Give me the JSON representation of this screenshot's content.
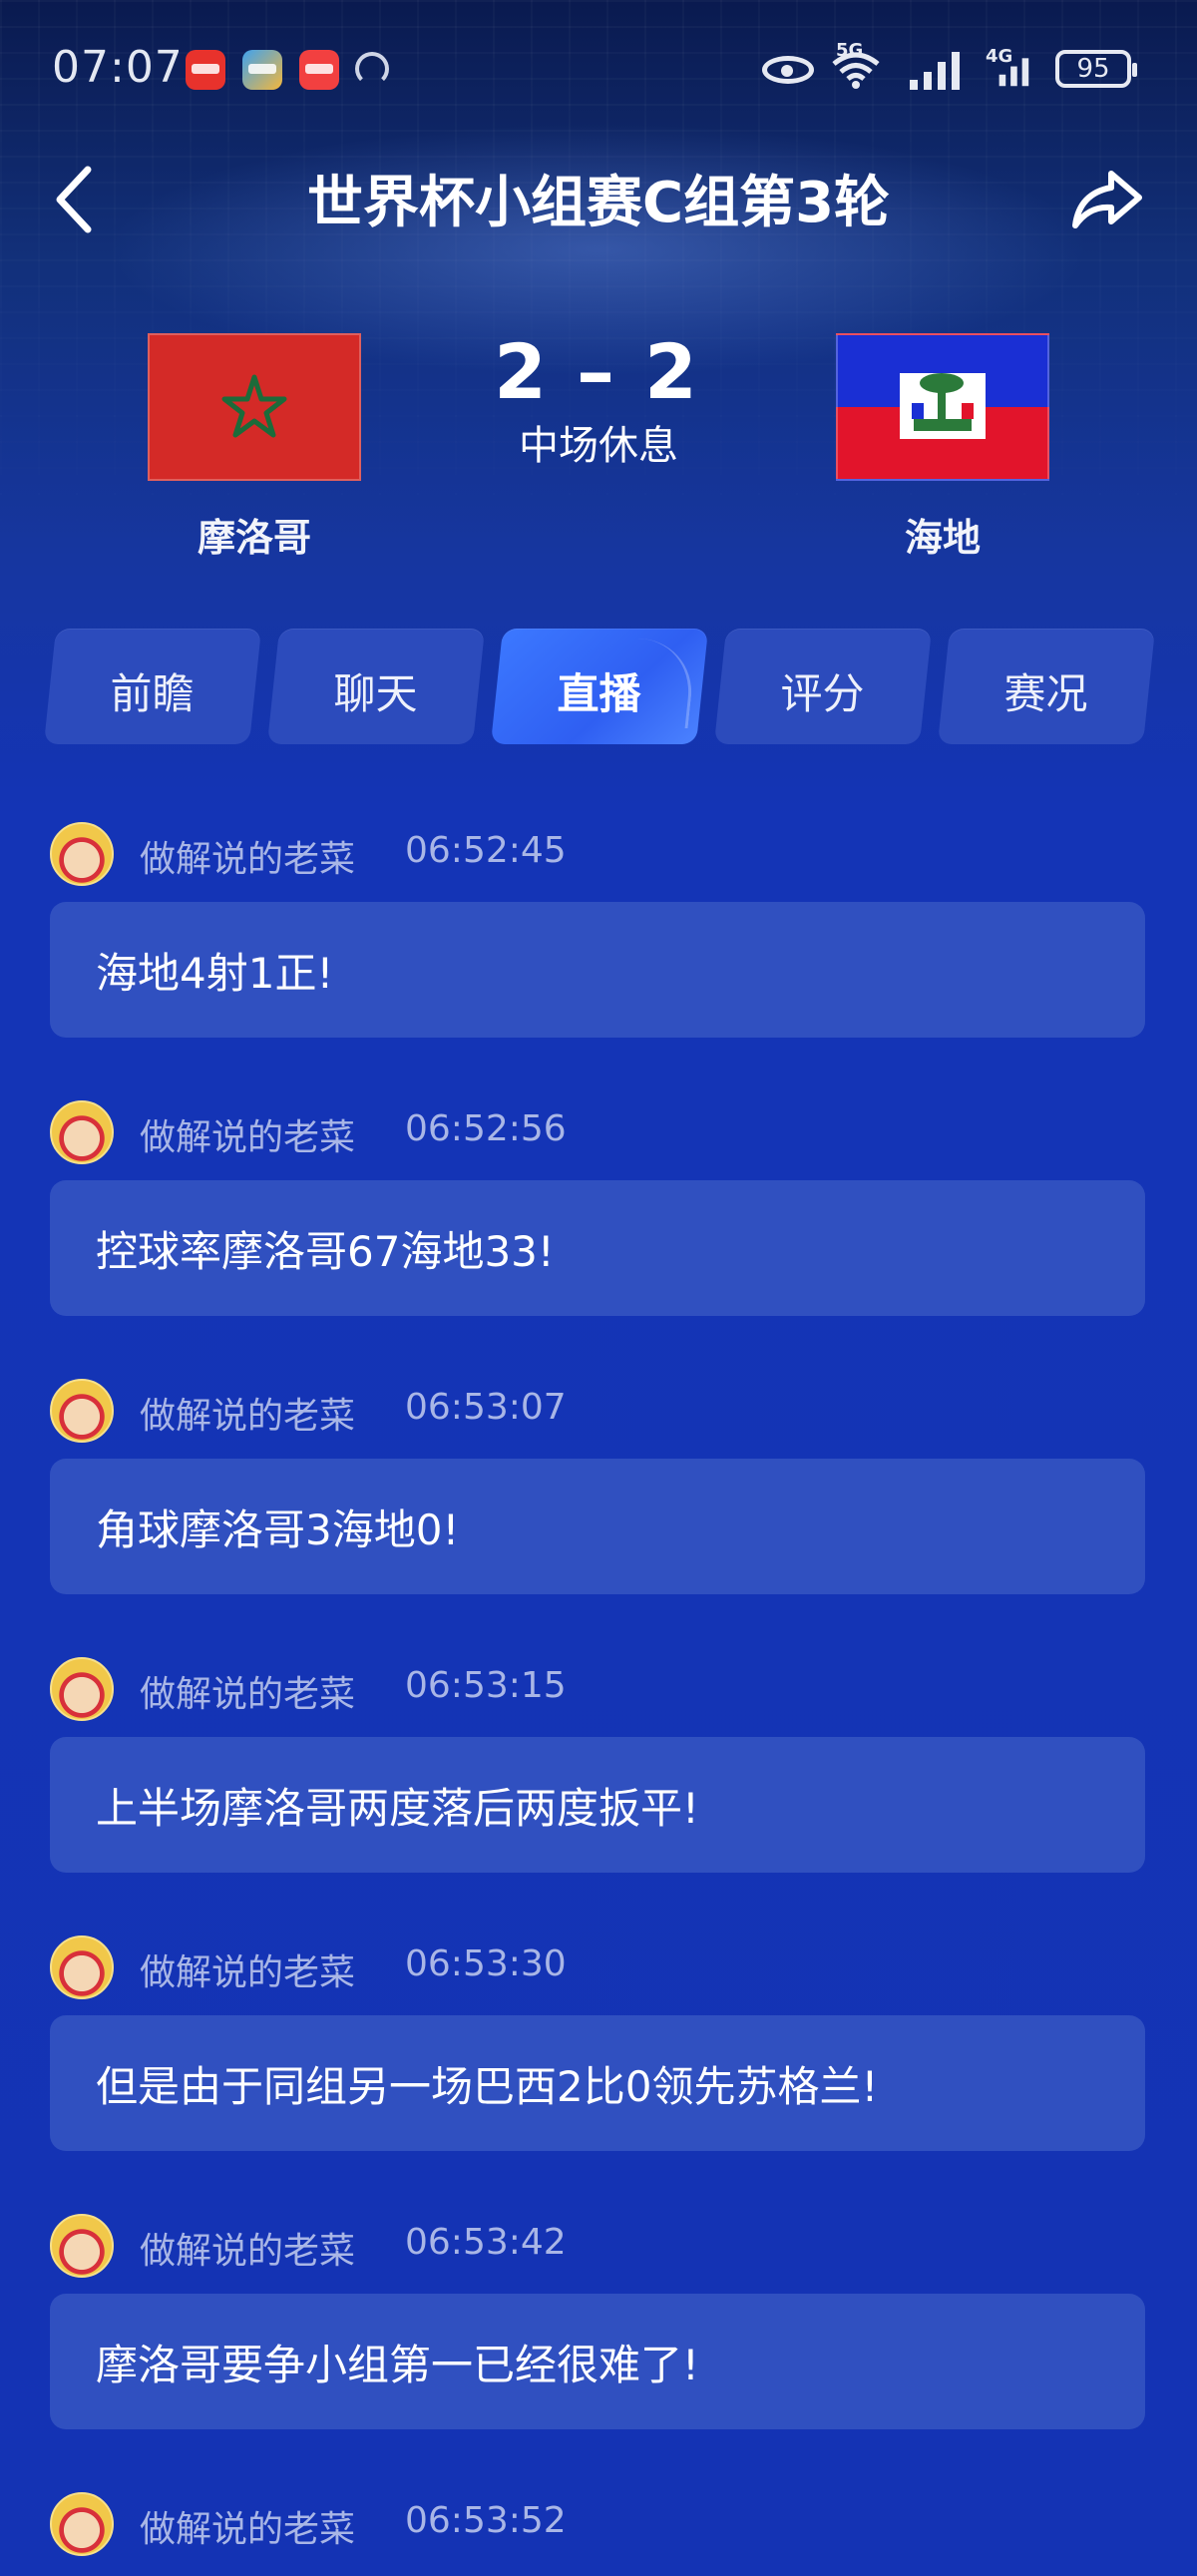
{
  "status_bar": {
    "time": "07:07",
    "network_1": "5G",
    "network_2": "4G",
    "battery": "95",
    "icons": [
      "huawei-app-icon",
      "map-app-icon",
      "red-app-icon",
      "gauge-icon",
      "eye-icon",
      "wifi-icon",
      "signal-icon",
      "signal-icon"
    ]
  },
  "header": {
    "title": "世界杯小组赛C组第3轮",
    "back_icon": "chevron-left-icon",
    "share_icon": "share-icon"
  },
  "match": {
    "home_team": "摩洛哥",
    "away_team": "海地",
    "home_score": "2",
    "separator": "–",
    "away_score": "2",
    "status": "中场休息",
    "home_flag_colors": {
      "field": "#d42a27",
      "star": "#1c6b3a"
    },
    "away_flag_colors": {
      "top": "#1a2fd4",
      "bottom": "#e2142b"
    }
  },
  "tabs": [
    {
      "label": "前瞻",
      "active": false
    },
    {
      "label": "聊天",
      "active": false
    },
    {
      "label": "直播",
      "active": true
    },
    {
      "label": "评分",
      "active": false
    },
    {
      "label": "赛况",
      "active": false
    }
  ],
  "feed": [
    {
      "author": "做解说的老菜",
      "time": "06:52:45",
      "text": "海地4射1正!"
    },
    {
      "author": "做解说的老菜",
      "time": "06:52:56",
      "text": "控球率摩洛哥67海地33!"
    },
    {
      "author": "做解说的老菜",
      "time": "06:53:07",
      "text": "角球摩洛哥3海地0!"
    },
    {
      "author": "做解说的老菜",
      "time": "06:53:15",
      "text": "上半场摩洛哥两度落后两度扳平!"
    },
    {
      "author": "做解说的老菜",
      "time": "06:53:30",
      "text": "但是由于同组另一场巴西2比0领先苏格兰!"
    },
    {
      "author": "做解说的老菜",
      "time": "06:53:42",
      "text": "摩洛哥要争小组第一已经很难了!"
    },
    {
      "author": "做解说的老菜",
      "time": "06:53:52",
      "text": ""
    }
  ],
  "colors": {
    "background": "#1434b0",
    "bubble": "#3050c0",
    "tab": "#2c4bbc",
    "tab_active": "#3c78ff",
    "meta_text": "#a9b6e6"
  }
}
